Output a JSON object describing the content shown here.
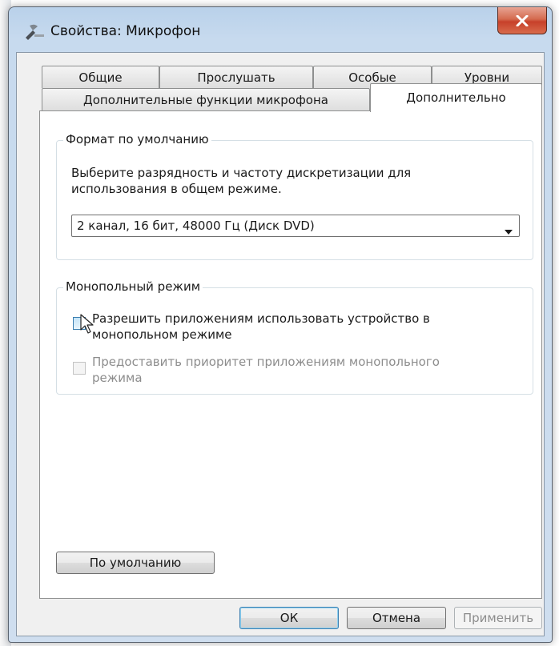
{
  "window": {
    "title": "Свойства: Микрофон",
    "close_icon": "close-x-icon",
    "title_icon": "microphone-icon"
  },
  "tabs_row1": [
    "Общие",
    "Прослушать",
    "Особые",
    "Уровни"
  ],
  "tabs_row2": [
    "Дополнительные функции микрофона",
    "Дополнительно"
  ],
  "active_tab": "Дополнительно",
  "default_format": {
    "group_title": "Формат по умолчанию",
    "description_line1": "Выберите разрядность и частоту дискретизации для",
    "description_line2": "использования в общем режиме.",
    "selected": "2 канал, 16 бит, 48000 Гц (Диск DVD)"
  },
  "exclusive": {
    "group_title": "Монопольный режим",
    "allow_line1": "Разрешить приложениям использовать устройство в",
    "allow_line2": "монопольном режиме",
    "allow_checked": false,
    "priority_line1": "Предоставить приоритет приложениям монопольного",
    "priority_line2": "режима",
    "priority_enabled": false
  },
  "restore_defaults": "По умолчанию",
  "buttons": {
    "ok": "ОК",
    "cancel": "Отмена",
    "apply": "Применить"
  }
}
